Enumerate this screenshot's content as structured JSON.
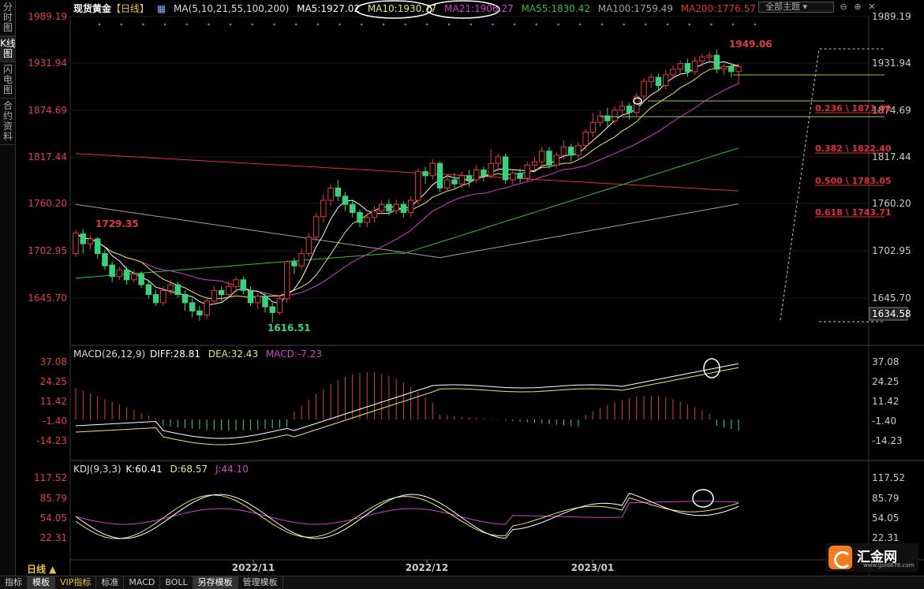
{
  "side_tabs": [
    {
      "label": "分时图",
      "active": false
    },
    {
      "label": "K线图",
      "active": true
    },
    {
      "label": "闪电图",
      "active": false
    },
    {
      "label": "合约资料",
      "active": false
    }
  ],
  "header": {
    "symbol": "现货黄金",
    "period_tag": "【日线】",
    "ma_label": "MA(5,10,21,55,100,200)",
    "ma5": "MA5:1927.02",
    "ma10": "MA10:1930.77",
    "ma21": "MA21:1906.27",
    "ma55": "MA55:1830.42",
    "ma100": "MA100:1759.49",
    "ma200": "MA200:1776.57",
    "theme_button": "全部主题",
    "colors": {
      "ma5": "#ffffff",
      "ma10": "#e8e86a",
      "ma21": "#d040d0",
      "ma55": "#30c030",
      "ma100": "#a0a0a0",
      "ma200": "#e03030"
    }
  },
  "price_axis": {
    "ticks": [
      "1989.19",
      "1931.94",
      "1874.69",
      "1817.44",
      "1760.20",
      "1702.95",
      "1645.70"
    ],
    "current": "1634.58"
  },
  "annotations": {
    "high": "1949.06",
    "low": "1616.51",
    "start": "1729.35",
    "fib": [
      "0.236 \\ 1871.09",
      "0.382 \\ 1822.40",
      "0.500 \\ 1783.05",
      "0.618 \\ 1743.71"
    ]
  },
  "macd": {
    "label": "MACD(26,12,9)",
    "diff": "DIFF:28.81",
    "dea": "DEA:32.43",
    "macd": "MACD:-7.23",
    "ticks": [
      "37.08",
      "24.25",
      "11.42",
      "-1.40",
      "-14.23"
    ]
  },
  "kdj": {
    "label": "KDJ(9,3,3)",
    "k": "K:60.41",
    "d": "D:68.57",
    "j": "J:44.10",
    "ticks": [
      "117.52",
      "85.79",
      "54.05",
      "22.31"
    ]
  },
  "time_axis": [
    "2022/11",
    "2022/12",
    "2023/01"
  ],
  "period_label": "日线 ▲",
  "bottom_tabs": [
    {
      "label": "指标",
      "active": false,
      "vip": false
    },
    {
      "label": "模板",
      "active": true,
      "vip": false
    },
    {
      "label": "VIP指标",
      "active": false,
      "vip": true
    },
    {
      "label": "标准",
      "active": false,
      "vip": false
    },
    {
      "label": "MACD",
      "active": false,
      "vip": false
    },
    {
      "label": "BOLL",
      "active": false,
      "vip": false
    },
    {
      "label": "另存模板",
      "active": true,
      "vip": false
    },
    {
      "label": "管理模板",
      "active": false,
      "vip": false
    }
  ],
  "logo": {
    "name": "汇金网",
    "url": "www.gold678.com"
  },
  "chart_data": {
    "type": "candlestick",
    "candles": [
      [
        1700,
        1725,
        1696,
        1729
      ],
      [
        1724,
        1712,
        1700,
        1730
      ],
      [
        1712,
        1718,
        1705,
        1722
      ],
      [
        1718,
        1700,
        1694,
        1720
      ],
      [
        1700,
        1685,
        1680,
        1705
      ],
      [
        1686,
        1672,
        1665,
        1690
      ],
      [
        1672,
        1680,
        1668,
        1684
      ],
      [
        1680,
        1668,
        1662,
        1684
      ],
      [
        1668,
        1675,
        1665,
        1680
      ],
      [
        1675,
        1662,
        1658,
        1678
      ],
      [
        1662,
        1650,
        1645,
        1668
      ],
      [
        1650,
        1640,
        1636,
        1656
      ],
      [
        1640,
        1655,
        1636,
        1660
      ],
      [
        1655,
        1662,
        1650,
        1668
      ],
      [
        1662,
        1650,
        1646,
        1666
      ],
      [
        1650,
        1640,
        1630,
        1655
      ],
      [
        1640,
        1630,
        1622,
        1645
      ],
      [
        1630,
        1625,
        1618,
        1636
      ],
      [
        1625,
        1642,
        1620,
        1648
      ],
      [
        1642,
        1655,
        1638,
        1660
      ],
      [
        1655,
        1650,
        1642,
        1660
      ],
      [
        1650,
        1660,
        1646,
        1666
      ],
      [
        1660,
        1668,
        1652,
        1672
      ],
      [
        1668,
        1655,
        1650,
        1672
      ],
      [
        1655,
        1640,
        1636,
        1660
      ],
      [
        1640,
        1648,
        1632,
        1652
      ],
      [
        1648,
        1635,
        1628,
        1652
      ],
      [
        1635,
        1628,
        1616,
        1640
      ],
      [
        1628,
        1645,
        1625,
        1650
      ],
      [
        1645,
        1690,
        1640,
        1692
      ],
      [
        1690,
        1685,
        1675,
        1695
      ],
      [
        1685,
        1700,
        1680,
        1706
      ],
      [
        1700,
        1720,
        1696,
        1725
      ],
      [
        1720,
        1745,
        1715,
        1750
      ],
      [
        1745,
        1765,
        1738,
        1772
      ],
      [
        1765,
        1780,
        1758,
        1785
      ],
      [
        1780,
        1770,
        1764,
        1790
      ],
      [
        1770,
        1760,
        1752,
        1775
      ],
      [
        1760,
        1750,
        1744,
        1764
      ],
      [
        1750,
        1738,
        1732,
        1754
      ],
      [
        1738,
        1744,
        1732,
        1750
      ],
      [
        1744,
        1752,
        1738,
        1758
      ],
      [
        1752,
        1760,
        1748,
        1765
      ],
      [
        1760,
        1752,
        1746,
        1766
      ],
      [
        1752,
        1760,
        1748,
        1766
      ],
      [
        1760,
        1750,
        1744,
        1764
      ],
      [
        1750,
        1765,
        1745,
        1770
      ],
      [
        1765,
        1800,
        1760,
        1804
      ],
      [
        1800,
        1795,
        1785,
        1806
      ],
      [
        1795,
        1810,
        1790,
        1815
      ],
      [
        1810,
        1780,
        1775,
        1812
      ],
      [
        1780,
        1790,
        1776,
        1796
      ],
      [
        1790,
        1785,
        1778,
        1798
      ],
      [
        1785,
        1795,
        1780,
        1800
      ],
      [
        1795,
        1790,
        1782,
        1802
      ],
      [
        1790,
        1802,
        1786,
        1808
      ],
      [
        1802,
        1795,
        1788,
        1806
      ],
      [
        1795,
        1810,
        1792,
        1828
      ],
      [
        1810,
        1818,
        1800,
        1822
      ],
      [
        1818,
        1790,
        1785,
        1822
      ],
      [
        1790,
        1798,
        1784,
        1802
      ],
      [
        1798,
        1792,
        1786,
        1804
      ],
      [
        1792,
        1808,
        1788,
        1812
      ],
      [
        1808,
        1812,
        1800,
        1818
      ],
      [
        1812,
        1825,
        1806,
        1830
      ],
      [
        1825,
        1808,
        1804,
        1830
      ],
      [
        1808,
        1820,
        1804,
        1824
      ],
      [
        1820,
        1830,
        1815,
        1838
      ],
      [
        1830,
        1820,
        1812,
        1834
      ],
      [
        1820,
        1832,
        1816,
        1836
      ],
      [
        1832,
        1848,
        1826,
        1852
      ],
      [
        1848,
        1860,
        1842,
        1872
      ],
      [
        1860,
        1868,
        1855,
        1874
      ],
      [
        1868,
        1862,
        1855,
        1878
      ],
      [
        1862,
        1875,
        1858,
        1880
      ],
      [
        1875,
        1880,
        1868,
        1886
      ],
      [
        1880,
        1872,
        1864,
        1884
      ],
      [
        1872,
        1892,
        1868,
        1896
      ],
      [
        1892,
        1910,
        1886,
        1914
      ],
      [
        1910,
        1915,
        1902,
        1920
      ],
      [
        1915,
        1905,
        1898,
        1920
      ],
      [
        1905,
        1918,
        1900,
        1924
      ],
      [
        1918,
        1925,
        1912,
        1930
      ],
      [
        1925,
        1932,
        1918,
        1936
      ],
      [
        1932,
        1922,
        1916,
        1938
      ],
      [
        1922,
        1935,
        1918,
        1940
      ],
      [
        1935,
        1940,
        1928,
        1944
      ],
      [
        1940,
        1942,
        1932,
        1946
      ],
      [
        1942,
        1925,
        1920,
        1949
      ],
      [
        1925,
        1928,
        1918,
        1932
      ],
      [
        1928,
        1922,
        1915,
        1932
      ],
      [
        1922,
        1928,
        1906,
        1932
      ]
    ],
    "price_range": [
      1600,
      2000
    ]
  }
}
